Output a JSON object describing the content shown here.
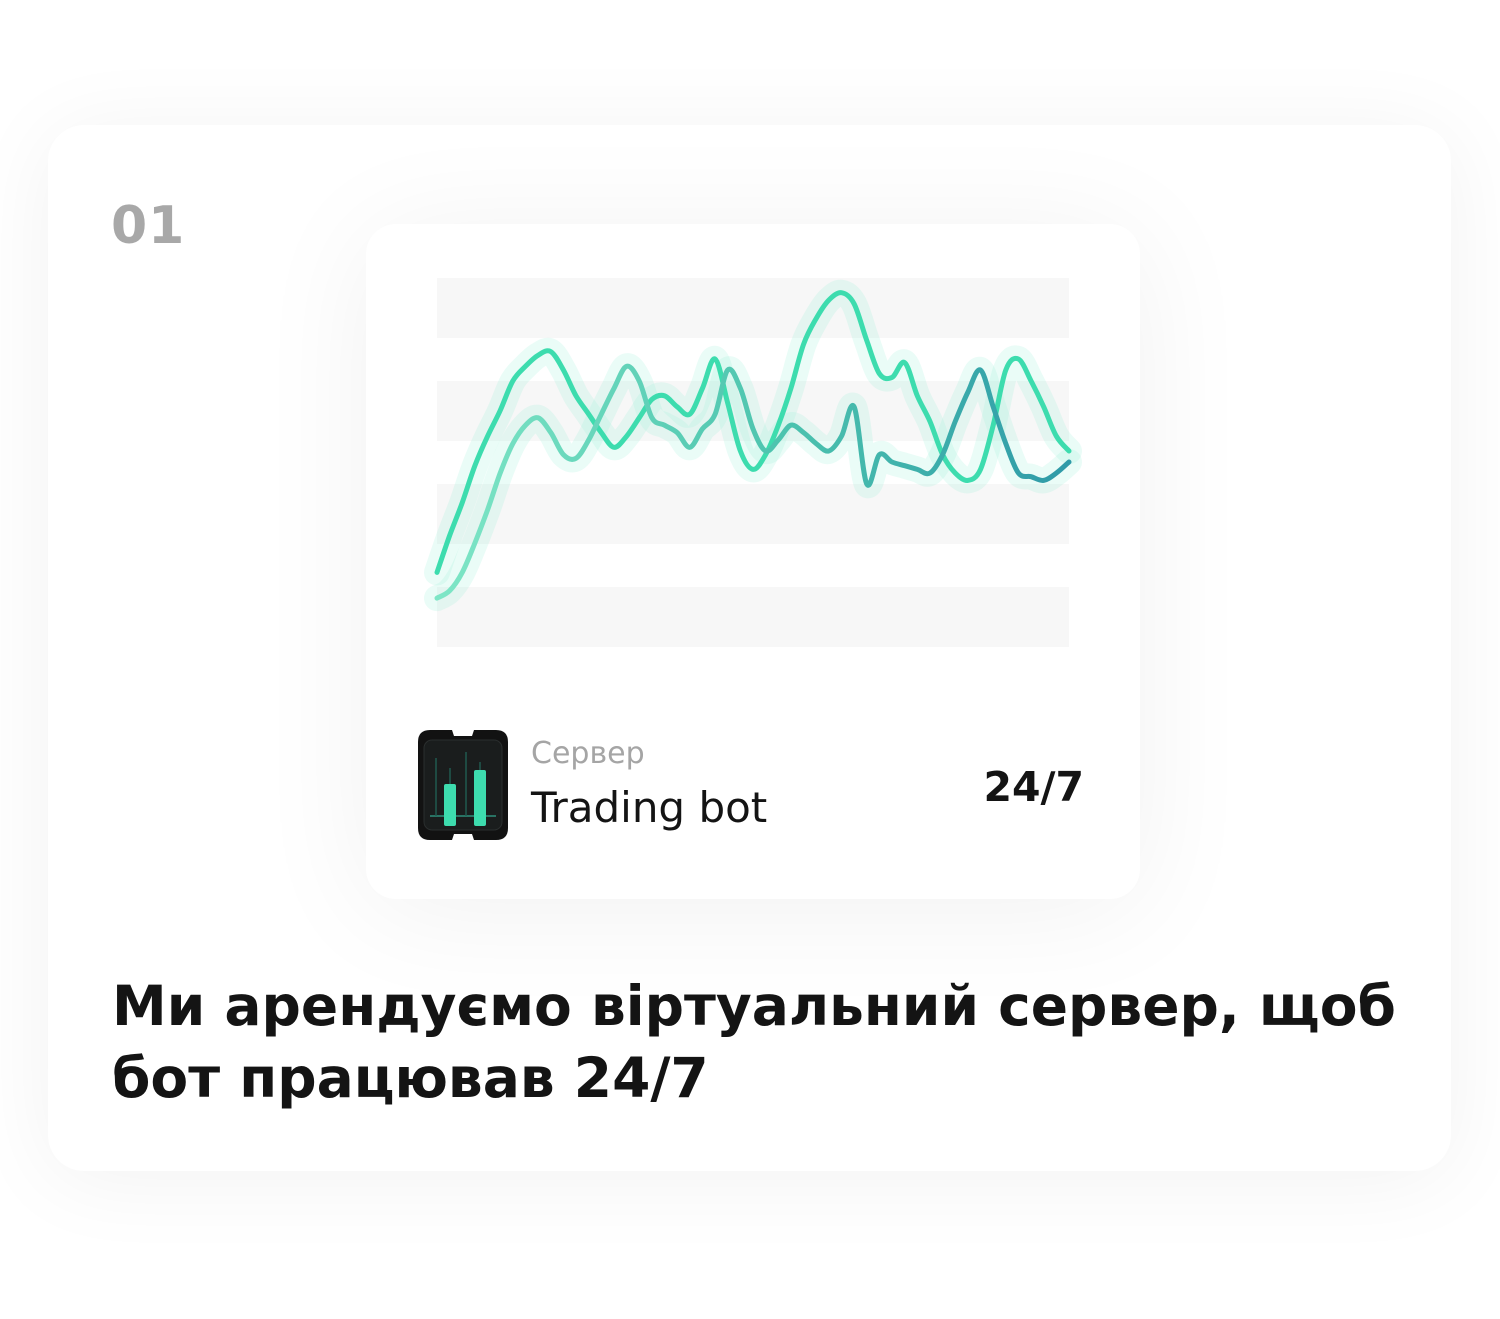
{
  "step": {
    "number": "01"
  },
  "server_card": {
    "label": "Сервер",
    "name": "Trading bot",
    "uptime": "24/7",
    "icon": "trading-bot-candlestick-icon"
  },
  "headline": "Ми арендуємо віртуальний сервер, щоб бот працював 24/7",
  "colors": {
    "accent_green": "#3ddcae",
    "accent_teal": "#2f9aa8",
    "glow": "#9ff3dc",
    "grid_band": "#f7f7f7",
    "muted_text": "#a5a5a5",
    "text": "#141414"
  },
  "chart_data": {
    "type": "line",
    "grid": true,
    "xlabel": "",
    "ylabel": "",
    "ylim": [
      0,
      100
    ],
    "x": [
      0,
      1,
      2,
      3,
      4,
      5,
      6,
      7,
      8,
      9,
      10,
      11,
      12,
      13,
      14,
      15,
      16,
      17,
      18,
      19,
      20,
      21,
      22,
      23,
      24,
      25,
      26,
      27,
      28,
      29,
      30,
      31,
      32,
      33,
      34,
      35,
      36,
      37,
      38,
      39,
      40,
      41,
      42,
      43,
      44,
      45,
      46,
      47,
      48,
      49,
      50
    ],
    "series": [
      {
        "values": [
          20,
          30,
          39,
          49,
          57,
          64,
          72,
          76,
          79,
          80,
          75,
          68,
          63,
          58,
          54,
          57,
          62,
          67,
          68,
          65,
          63,
          70,
          78,
          66,
          53,
          48,
          52,
          60,
          70,
          82,
          89,
          94,
          96,
          93,
          83,
          74,
          73,
          77,
          68,
          61,
          52,
          47,
          45,
          48,
          60,
          75,
          78,
          72,
          65,
          57,
          53
        ]
      },
      {
        "values": [
          13,
          15,
          20,
          28,
          37,
          47,
          55,
          60,
          62,
          58,
          52,
          51,
          56,
          63,
          70,
          76,
          72,
          62,
          60,
          58,
          54,
          59,
          63,
          75,
          70,
          59,
          53,
          56,
          60,
          58,
          55,
          53,
          57,
          65,
          44,
          52,
          50,
          49,
          48,
          47,
          52,
          61,
          69,
          75,
          65,
          55,
          47,
          46,
          45,
          47,
          50
        ]
      }
    ]
  }
}
